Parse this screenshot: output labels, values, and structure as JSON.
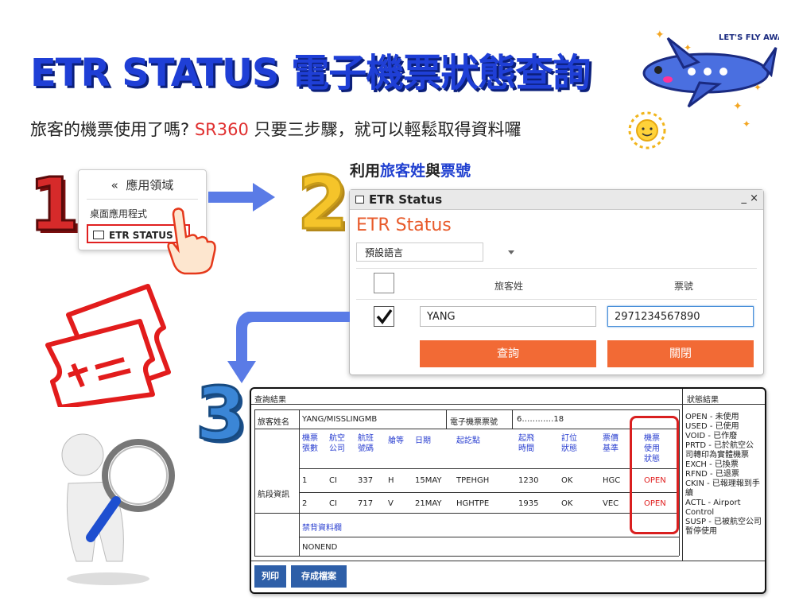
{
  "header": {
    "title": "ETR STATUS 電子機票狀態查詢",
    "subtitle_pre": "旅客的機票使用了嗎?",
    "subtitle_code": "SR360",
    "subtitle_post": "只要三步驟，就可以輕鬆取得資料囉"
  },
  "decor": {
    "plane_badge": "LET'S FLY AWAY!"
  },
  "steps": {
    "one": "1",
    "two": "2",
    "three": "3"
  },
  "menu": {
    "header": "應用領域",
    "item": "桌面應用程式",
    "selected": "ETR STATUS"
  },
  "step2": {
    "lead_pre": "利用",
    "lead_a": "旅客姓",
    "lead_mid": "與",
    "lead_b": "票號",
    "window_title": "ETR Status",
    "window_controls": "_ ×",
    "heading": "ETR Status",
    "language": "預設語言",
    "col_surname": "旅客姓",
    "col_ticket": "票號",
    "surname_value": "YANG",
    "ticket_value": "2971234567890",
    "query_button": "查詢",
    "close_button": "關閉",
    "row_checked": true
  },
  "result": {
    "label_result": "查詢結果",
    "label_status_result": "狀態結果",
    "label_passenger": "旅客姓名",
    "passenger_value": "YANG/MISSLINGMB",
    "label_eticket": "電子機票票號",
    "eticket_value": "6…………18",
    "columns": [
      "機票張數",
      "航空公司",
      "航班號碼",
      "艙等",
      "日期",
      "起訖點",
      "起飛時間",
      "訂位狀態",
      "票價基準",
      "機票使用狀態"
    ],
    "label_segments": "航段資訊",
    "rows": [
      [
        "1",
        "CI",
        "337",
        "H",
        "15MAY",
        "TPEHGH",
        "1230",
        "OK",
        "HGC",
        "OPEN"
      ],
      [
        "2",
        "CI",
        "717",
        "V",
        "21MAY",
        "HGHTPE",
        "1935",
        "OK",
        "VEC",
        "OPEN"
      ]
    ],
    "label_endorse": "禁背資料欄",
    "endorse_value": "NONEND",
    "legend": [
      "OPEN - 未使用",
      "USED - 已使用",
      "VOID - 已作廢",
      "PRTD - 已於航空公司轉印為實體機票",
      "EXCH - 已換票",
      "RFND - 已退票",
      "CKIN - 已報理報到手續",
      "ACTL - Airport Control",
      "SUSP - 已被航空公司暫停使用"
    ],
    "print_button": "列印",
    "save_button": "存成檔案"
  },
  "colors": {
    "title_blue": "#1f3fd6",
    "accent_orange": "#f26a35",
    "highlight_red": "#e02020",
    "button_blue": "#2e5fa8"
  }
}
